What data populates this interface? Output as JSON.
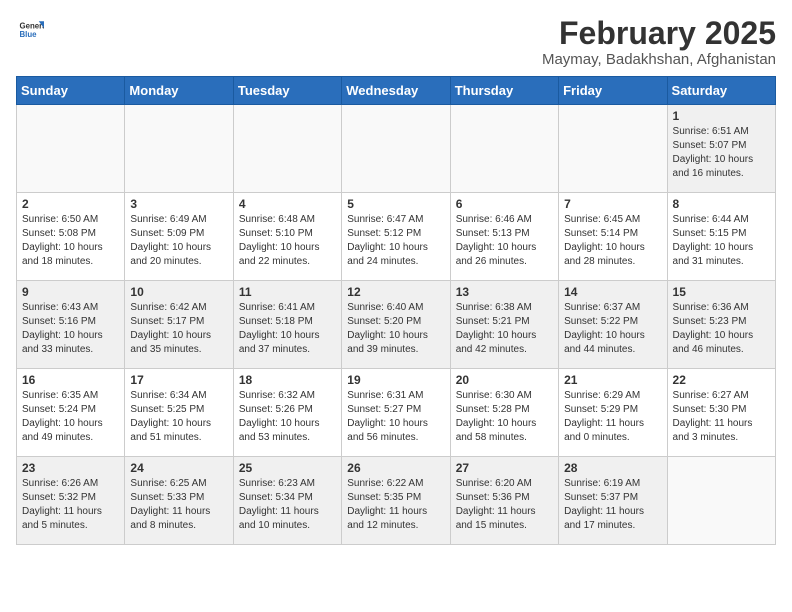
{
  "header": {
    "logo_general": "General",
    "logo_blue": "Blue",
    "title": "February 2025",
    "subtitle": "Maymay, Badakhshan, Afghanistan"
  },
  "weekdays": [
    "Sunday",
    "Monday",
    "Tuesday",
    "Wednesday",
    "Thursday",
    "Friday",
    "Saturday"
  ],
  "weeks": [
    [
      {
        "day": "",
        "info": ""
      },
      {
        "day": "",
        "info": ""
      },
      {
        "day": "",
        "info": ""
      },
      {
        "day": "",
        "info": ""
      },
      {
        "day": "",
        "info": ""
      },
      {
        "day": "",
        "info": ""
      },
      {
        "day": "1",
        "info": "Sunrise: 6:51 AM\nSunset: 5:07 PM\nDaylight: 10 hours\nand 16 minutes."
      }
    ],
    [
      {
        "day": "2",
        "info": "Sunrise: 6:50 AM\nSunset: 5:08 PM\nDaylight: 10 hours\nand 18 minutes."
      },
      {
        "day": "3",
        "info": "Sunrise: 6:49 AM\nSunset: 5:09 PM\nDaylight: 10 hours\nand 20 minutes."
      },
      {
        "day": "4",
        "info": "Sunrise: 6:48 AM\nSunset: 5:10 PM\nDaylight: 10 hours\nand 22 minutes."
      },
      {
        "day": "5",
        "info": "Sunrise: 6:47 AM\nSunset: 5:12 PM\nDaylight: 10 hours\nand 24 minutes."
      },
      {
        "day": "6",
        "info": "Sunrise: 6:46 AM\nSunset: 5:13 PM\nDaylight: 10 hours\nand 26 minutes."
      },
      {
        "day": "7",
        "info": "Sunrise: 6:45 AM\nSunset: 5:14 PM\nDaylight: 10 hours\nand 28 minutes."
      },
      {
        "day": "8",
        "info": "Sunrise: 6:44 AM\nSunset: 5:15 PM\nDaylight: 10 hours\nand 31 minutes."
      }
    ],
    [
      {
        "day": "9",
        "info": "Sunrise: 6:43 AM\nSunset: 5:16 PM\nDaylight: 10 hours\nand 33 minutes."
      },
      {
        "day": "10",
        "info": "Sunrise: 6:42 AM\nSunset: 5:17 PM\nDaylight: 10 hours\nand 35 minutes."
      },
      {
        "day": "11",
        "info": "Sunrise: 6:41 AM\nSunset: 5:18 PM\nDaylight: 10 hours\nand 37 minutes."
      },
      {
        "day": "12",
        "info": "Sunrise: 6:40 AM\nSunset: 5:20 PM\nDaylight: 10 hours\nand 39 minutes."
      },
      {
        "day": "13",
        "info": "Sunrise: 6:38 AM\nSunset: 5:21 PM\nDaylight: 10 hours\nand 42 minutes."
      },
      {
        "day": "14",
        "info": "Sunrise: 6:37 AM\nSunset: 5:22 PM\nDaylight: 10 hours\nand 44 minutes."
      },
      {
        "day": "15",
        "info": "Sunrise: 6:36 AM\nSunset: 5:23 PM\nDaylight: 10 hours\nand 46 minutes."
      }
    ],
    [
      {
        "day": "16",
        "info": "Sunrise: 6:35 AM\nSunset: 5:24 PM\nDaylight: 10 hours\nand 49 minutes."
      },
      {
        "day": "17",
        "info": "Sunrise: 6:34 AM\nSunset: 5:25 PM\nDaylight: 10 hours\nand 51 minutes."
      },
      {
        "day": "18",
        "info": "Sunrise: 6:32 AM\nSunset: 5:26 PM\nDaylight: 10 hours\nand 53 minutes."
      },
      {
        "day": "19",
        "info": "Sunrise: 6:31 AM\nSunset: 5:27 PM\nDaylight: 10 hours\nand 56 minutes."
      },
      {
        "day": "20",
        "info": "Sunrise: 6:30 AM\nSunset: 5:28 PM\nDaylight: 10 hours\nand 58 minutes."
      },
      {
        "day": "21",
        "info": "Sunrise: 6:29 AM\nSunset: 5:29 PM\nDaylight: 11 hours\nand 0 minutes."
      },
      {
        "day": "22",
        "info": "Sunrise: 6:27 AM\nSunset: 5:30 PM\nDaylight: 11 hours\nand 3 minutes."
      }
    ],
    [
      {
        "day": "23",
        "info": "Sunrise: 6:26 AM\nSunset: 5:32 PM\nDaylight: 11 hours\nand 5 minutes."
      },
      {
        "day": "24",
        "info": "Sunrise: 6:25 AM\nSunset: 5:33 PM\nDaylight: 11 hours\nand 8 minutes."
      },
      {
        "day": "25",
        "info": "Sunrise: 6:23 AM\nSunset: 5:34 PM\nDaylight: 11 hours\nand 10 minutes."
      },
      {
        "day": "26",
        "info": "Sunrise: 6:22 AM\nSunset: 5:35 PM\nDaylight: 11 hours\nand 12 minutes."
      },
      {
        "day": "27",
        "info": "Sunrise: 6:20 AM\nSunset: 5:36 PM\nDaylight: 11 hours\nand 15 minutes."
      },
      {
        "day": "28",
        "info": "Sunrise: 6:19 AM\nSunset: 5:37 PM\nDaylight: 11 hours\nand 17 minutes."
      },
      {
        "day": "",
        "info": ""
      }
    ]
  ]
}
